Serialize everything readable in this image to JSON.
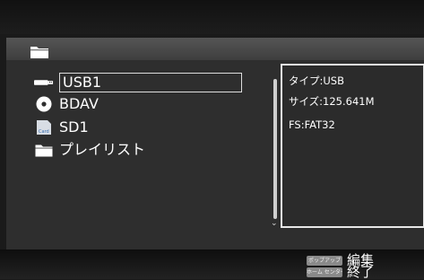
{
  "devices": [
    {
      "label": "USB1",
      "icon": "usb-icon",
      "selected": true
    },
    {
      "label": "BDAV",
      "icon": "disc-icon",
      "selected": false
    },
    {
      "label": "SD1",
      "icon": "sd-card-icon",
      "selected": false
    },
    {
      "label": "プレイリスト",
      "icon": "folder-icon",
      "selected": false
    }
  ],
  "sd_icon_text": "Card",
  "info": {
    "type": "タイプ:USB",
    "size": "サイズ:125.641M",
    "fs": "FS:FAT32"
  },
  "footer": {
    "popup_key": "ポップアップ",
    "popup_label": "編集",
    "center_key": "ホーム センター",
    "center_label": "終了"
  },
  "colors": {
    "background": "#2e2e2e",
    "selection_border": "#dddddd",
    "panel_border": "#e8e8e8"
  }
}
